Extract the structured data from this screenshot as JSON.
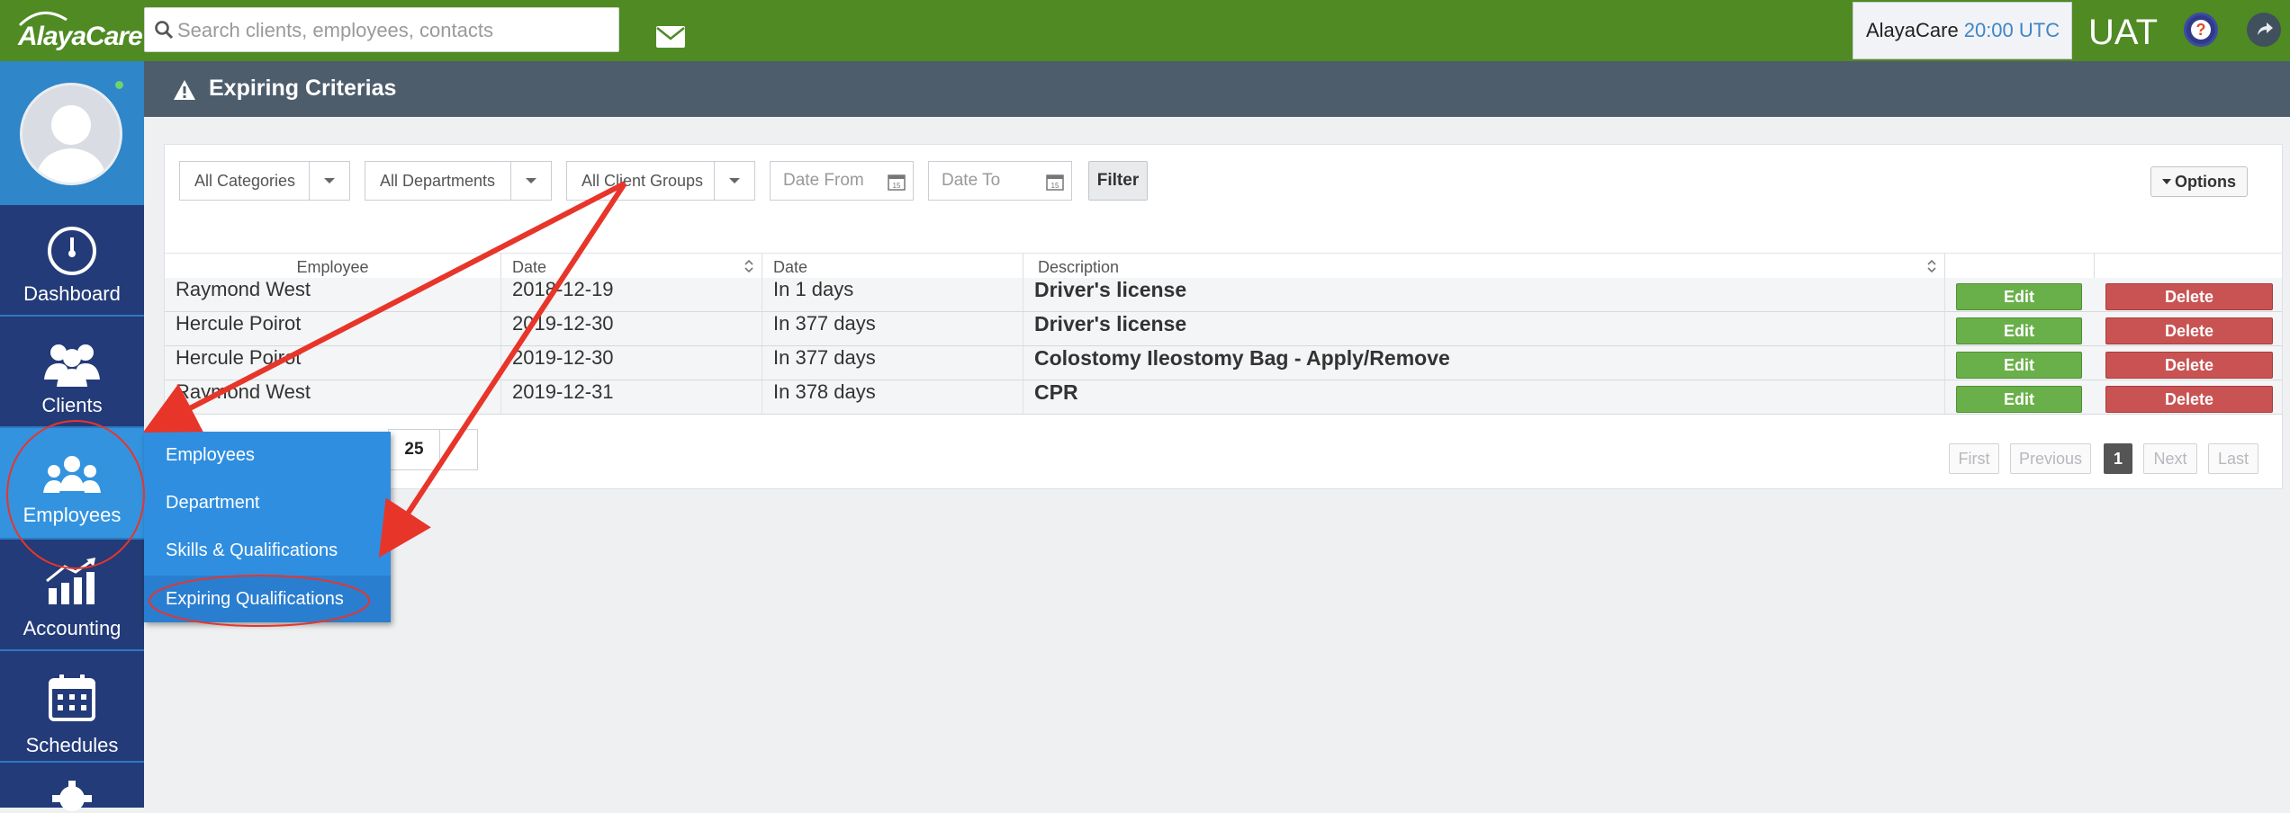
{
  "app": {
    "logo_text": "AlayaCare",
    "search_placeholder": "Search clients, employees, contacts",
    "clock_brand": "AlayaCare",
    "clock_time": "20:00 UTC",
    "environment": "UAT",
    "help_label": "?"
  },
  "sidebar": {
    "items": [
      {
        "label": "Dashboard"
      },
      {
        "label": "Clients"
      },
      {
        "label": "Employees"
      },
      {
        "label": "Accounting"
      },
      {
        "label": "Schedules"
      }
    ]
  },
  "page": {
    "title": "Expiring Criterias"
  },
  "filters": {
    "categories": "All Categories",
    "departments": "All Departments",
    "client_groups": "All Client Groups",
    "date_from_placeholder": "Date From",
    "date_to_placeholder": "Date To",
    "filter_label": "Filter",
    "options_label": "Options"
  },
  "table": {
    "headers": [
      "Employee",
      "Date",
      "Date",
      "Description"
    ],
    "rows": [
      {
        "employee": "Raymond West",
        "date": "2018-12-19",
        "relative": "In 1 days",
        "description": "Driver's license"
      },
      {
        "employee": "Hercule Poirot",
        "date": "2019-12-30",
        "relative": "In 377 days",
        "description": "Driver's license"
      },
      {
        "employee": "Hercule Poirot",
        "date": "2019-12-30",
        "relative": "In 377 days",
        "description": "Colostomy Ileostomy Bag - Apply/Remove"
      },
      {
        "employee": "Raymond West",
        "date": "2019-12-31",
        "relative": "In 378 days",
        "description": "CPR"
      }
    ],
    "edit_label": "Edit",
    "delete_label": "Delete",
    "page_size": "25"
  },
  "pagination": {
    "first": "First",
    "previous": "Previous",
    "current": "1",
    "next": "Next",
    "last": "Last"
  },
  "submenu": {
    "items": [
      "Employees",
      "Department",
      "Skills & Qualifications",
      "Expiring Qualifications"
    ]
  },
  "colors": {
    "topbar": "#4f8a23",
    "sidebar": "#233b78",
    "active_nav": "#3393df",
    "edit": "#6ab04a",
    "delete": "#c95353",
    "annotation": "#e8352a"
  }
}
